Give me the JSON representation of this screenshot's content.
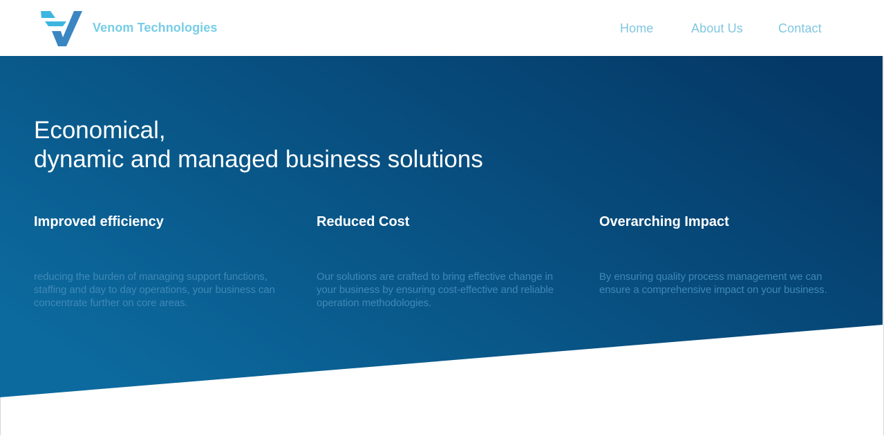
{
  "brand": {
    "name": "Venom Technologies",
    "logo_icon": "v-chevron-logo-icon",
    "colors": {
      "light": "#3cb6e1",
      "dark": "#3a86c2",
      "text": "#76cde6"
    }
  },
  "nav": {
    "items": [
      {
        "label": "Home"
      },
      {
        "label": "About Us"
      },
      {
        "label": "Contact"
      }
    ]
  },
  "hero": {
    "headline_line1": "Economical,",
    "headline_line2": "dynamic and managed business solutions",
    "gradient": {
      "start": "#0c6a9e",
      "end": "#043866"
    },
    "features": [
      {
        "title": "Improved efficiency",
        "text": "reducing the burden of managing support functions, staffing and day to day operations, your business can concentrate further on core areas."
      },
      {
        "title": "Reduced Cost",
        "text": "Our solutions are crafted to bring effective change in your business by ensuring cost-effective and reliable operation methodologies."
      },
      {
        "title": "Overarching Impact",
        "text": "By ensuring quality process management we can ensure a comprehensive impact on your business."
      }
    ]
  }
}
